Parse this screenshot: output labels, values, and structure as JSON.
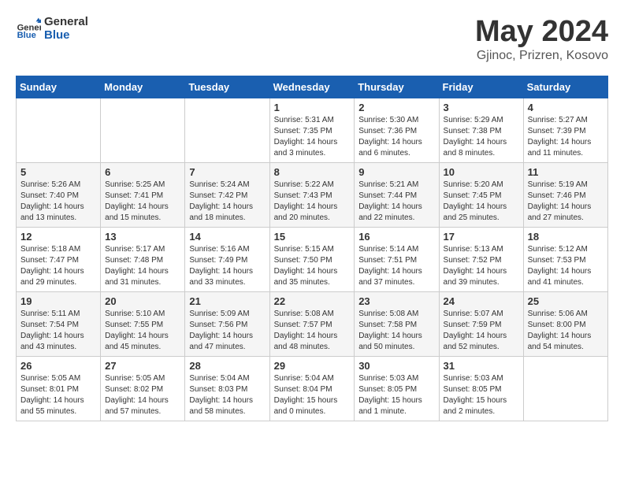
{
  "header": {
    "logo": {
      "general": "General",
      "blue": "Blue"
    },
    "title": "May 2024",
    "location": "Gjinoc, Prizren, Kosovo"
  },
  "calendar": {
    "weekdays": [
      "Sunday",
      "Monday",
      "Tuesday",
      "Wednesday",
      "Thursday",
      "Friday",
      "Saturday"
    ],
    "weeks": [
      [
        {
          "day": null,
          "text": null
        },
        {
          "day": null,
          "text": null
        },
        {
          "day": null,
          "text": null
        },
        {
          "day": "1",
          "text": "Sunrise: 5:31 AM\nSunset: 7:35 PM\nDaylight: 14 hours\nand 3 minutes."
        },
        {
          "day": "2",
          "text": "Sunrise: 5:30 AM\nSunset: 7:36 PM\nDaylight: 14 hours\nand 6 minutes."
        },
        {
          "day": "3",
          "text": "Sunrise: 5:29 AM\nSunset: 7:38 PM\nDaylight: 14 hours\nand 8 minutes."
        },
        {
          "day": "4",
          "text": "Sunrise: 5:27 AM\nSunset: 7:39 PM\nDaylight: 14 hours\nand 11 minutes."
        }
      ],
      [
        {
          "day": "5",
          "text": "Sunrise: 5:26 AM\nSunset: 7:40 PM\nDaylight: 14 hours\nand 13 minutes."
        },
        {
          "day": "6",
          "text": "Sunrise: 5:25 AM\nSunset: 7:41 PM\nDaylight: 14 hours\nand 15 minutes."
        },
        {
          "day": "7",
          "text": "Sunrise: 5:24 AM\nSunset: 7:42 PM\nDaylight: 14 hours\nand 18 minutes."
        },
        {
          "day": "8",
          "text": "Sunrise: 5:22 AM\nSunset: 7:43 PM\nDaylight: 14 hours\nand 20 minutes."
        },
        {
          "day": "9",
          "text": "Sunrise: 5:21 AM\nSunset: 7:44 PM\nDaylight: 14 hours\nand 22 minutes."
        },
        {
          "day": "10",
          "text": "Sunrise: 5:20 AM\nSunset: 7:45 PM\nDaylight: 14 hours\nand 25 minutes."
        },
        {
          "day": "11",
          "text": "Sunrise: 5:19 AM\nSunset: 7:46 PM\nDaylight: 14 hours\nand 27 minutes."
        }
      ],
      [
        {
          "day": "12",
          "text": "Sunrise: 5:18 AM\nSunset: 7:47 PM\nDaylight: 14 hours\nand 29 minutes."
        },
        {
          "day": "13",
          "text": "Sunrise: 5:17 AM\nSunset: 7:48 PM\nDaylight: 14 hours\nand 31 minutes."
        },
        {
          "day": "14",
          "text": "Sunrise: 5:16 AM\nSunset: 7:49 PM\nDaylight: 14 hours\nand 33 minutes."
        },
        {
          "day": "15",
          "text": "Sunrise: 5:15 AM\nSunset: 7:50 PM\nDaylight: 14 hours\nand 35 minutes."
        },
        {
          "day": "16",
          "text": "Sunrise: 5:14 AM\nSunset: 7:51 PM\nDaylight: 14 hours\nand 37 minutes."
        },
        {
          "day": "17",
          "text": "Sunrise: 5:13 AM\nSunset: 7:52 PM\nDaylight: 14 hours\nand 39 minutes."
        },
        {
          "day": "18",
          "text": "Sunrise: 5:12 AM\nSunset: 7:53 PM\nDaylight: 14 hours\nand 41 minutes."
        }
      ],
      [
        {
          "day": "19",
          "text": "Sunrise: 5:11 AM\nSunset: 7:54 PM\nDaylight: 14 hours\nand 43 minutes."
        },
        {
          "day": "20",
          "text": "Sunrise: 5:10 AM\nSunset: 7:55 PM\nDaylight: 14 hours\nand 45 minutes."
        },
        {
          "day": "21",
          "text": "Sunrise: 5:09 AM\nSunset: 7:56 PM\nDaylight: 14 hours\nand 47 minutes."
        },
        {
          "day": "22",
          "text": "Sunrise: 5:08 AM\nSunset: 7:57 PM\nDaylight: 14 hours\nand 48 minutes."
        },
        {
          "day": "23",
          "text": "Sunrise: 5:08 AM\nSunset: 7:58 PM\nDaylight: 14 hours\nand 50 minutes."
        },
        {
          "day": "24",
          "text": "Sunrise: 5:07 AM\nSunset: 7:59 PM\nDaylight: 14 hours\nand 52 minutes."
        },
        {
          "day": "25",
          "text": "Sunrise: 5:06 AM\nSunset: 8:00 PM\nDaylight: 14 hours\nand 54 minutes."
        }
      ],
      [
        {
          "day": "26",
          "text": "Sunrise: 5:05 AM\nSunset: 8:01 PM\nDaylight: 14 hours\nand 55 minutes."
        },
        {
          "day": "27",
          "text": "Sunrise: 5:05 AM\nSunset: 8:02 PM\nDaylight: 14 hours\nand 57 minutes."
        },
        {
          "day": "28",
          "text": "Sunrise: 5:04 AM\nSunset: 8:03 PM\nDaylight: 14 hours\nand 58 minutes."
        },
        {
          "day": "29",
          "text": "Sunrise: 5:04 AM\nSunset: 8:04 PM\nDaylight: 15 hours\nand 0 minutes."
        },
        {
          "day": "30",
          "text": "Sunrise: 5:03 AM\nSunset: 8:05 PM\nDaylight: 15 hours\nand 1 minute."
        },
        {
          "day": "31",
          "text": "Sunrise: 5:03 AM\nSunset: 8:05 PM\nDaylight: 15 hours\nand 2 minutes."
        },
        {
          "day": null,
          "text": null
        }
      ]
    ]
  }
}
